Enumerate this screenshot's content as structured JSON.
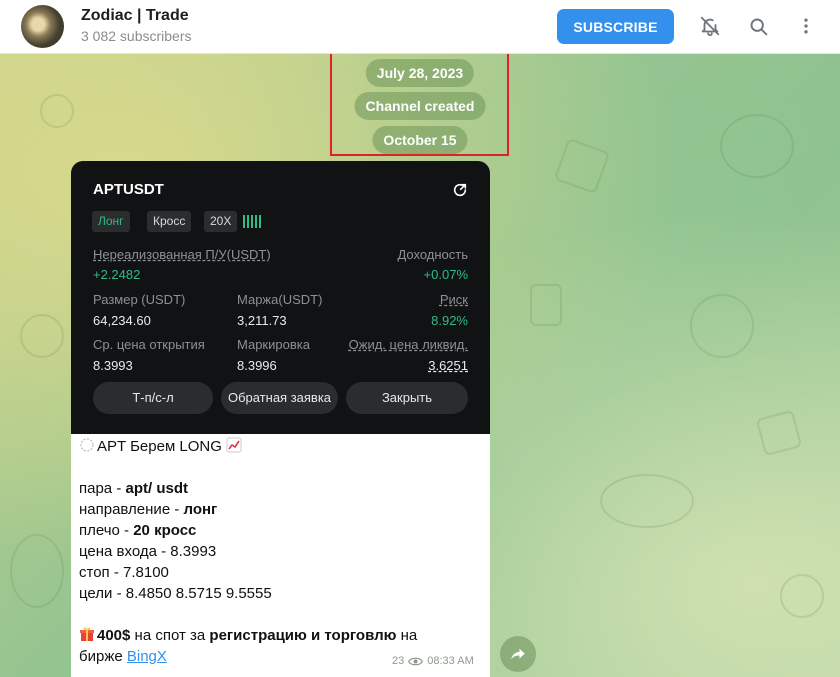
{
  "channel": {
    "name": "Zodiac | Trade",
    "subscribers": "3 082 subscribers",
    "subscribe_label": "SUBSCRIBE",
    "accent": "#3390ec"
  },
  "header_icons": [
    "bell-off-icon",
    "search-icon",
    "more-vertical-icon"
  ],
  "service": {
    "date1": "July 28, 2023",
    "created": "Channel created",
    "date2": "October 15"
  },
  "card": {
    "symbol": "APTUSDT",
    "tag_long": "Лонг",
    "tag_cross": "Кросс",
    "tag_leverage": "20X",
    "pnl_label": "Нереализованная П/У(USDT)",
    "pnl_value": "+2.2482",
    "yield_label": "Доходность",
    "yield_value": "+0.07%",
    "size_label": "Размер (USDT)",
    "size_value": "64,234.60",
    "margin_label": "Маржа(USDT)",
    "margin_value": "3,211.73",
    "risk_label": "Риск",
    "risk_value": "8.92%",
    "entry_label": "Ср. цена открытия",
    "entry_value": "8.3993",
    "mark_label": "Маркировка",
    "mark_value": "8.3996",
    "liq_label": "Ожид. цена ликвид.",
    "liq_value": "3.6251",
    "btn_tpsl": "Т-п/с-л",
    "btn_reverse": "Обратная заявка",
    "btn_close": "Закрыть",
    "green": "#2ebd85"
  },
  "post": {
    "headline": "APT Берем LONG",
    "pair_label": "пара - ",
    "pair_value": "apt/ usdt",
    "dir_label": "направление - ",
    "dir_value": "лонг",
    "lev_label": "плечо - ",
    "lev_value": "20 кросс",
    "entry_label": "цена входа - ",
    "entry_value": "8.3993",
    "stop_label": "стоп - ",
    "stop_value": "7.8100",
    "targets_label": "цели - ",
    "targets_value": "8.4850 8.5715 9.5555",
    "promo_amount": "400$",
    "promo_mid": " на спот за ",
    "promo_bold": "регистрацию и торговлю",
    "promo_end": " на",
    "promo_line2": "бирже ",
    "promo_link": "BingX",
    "views": "23",
    "time": "08:33 AM"
  }
}
